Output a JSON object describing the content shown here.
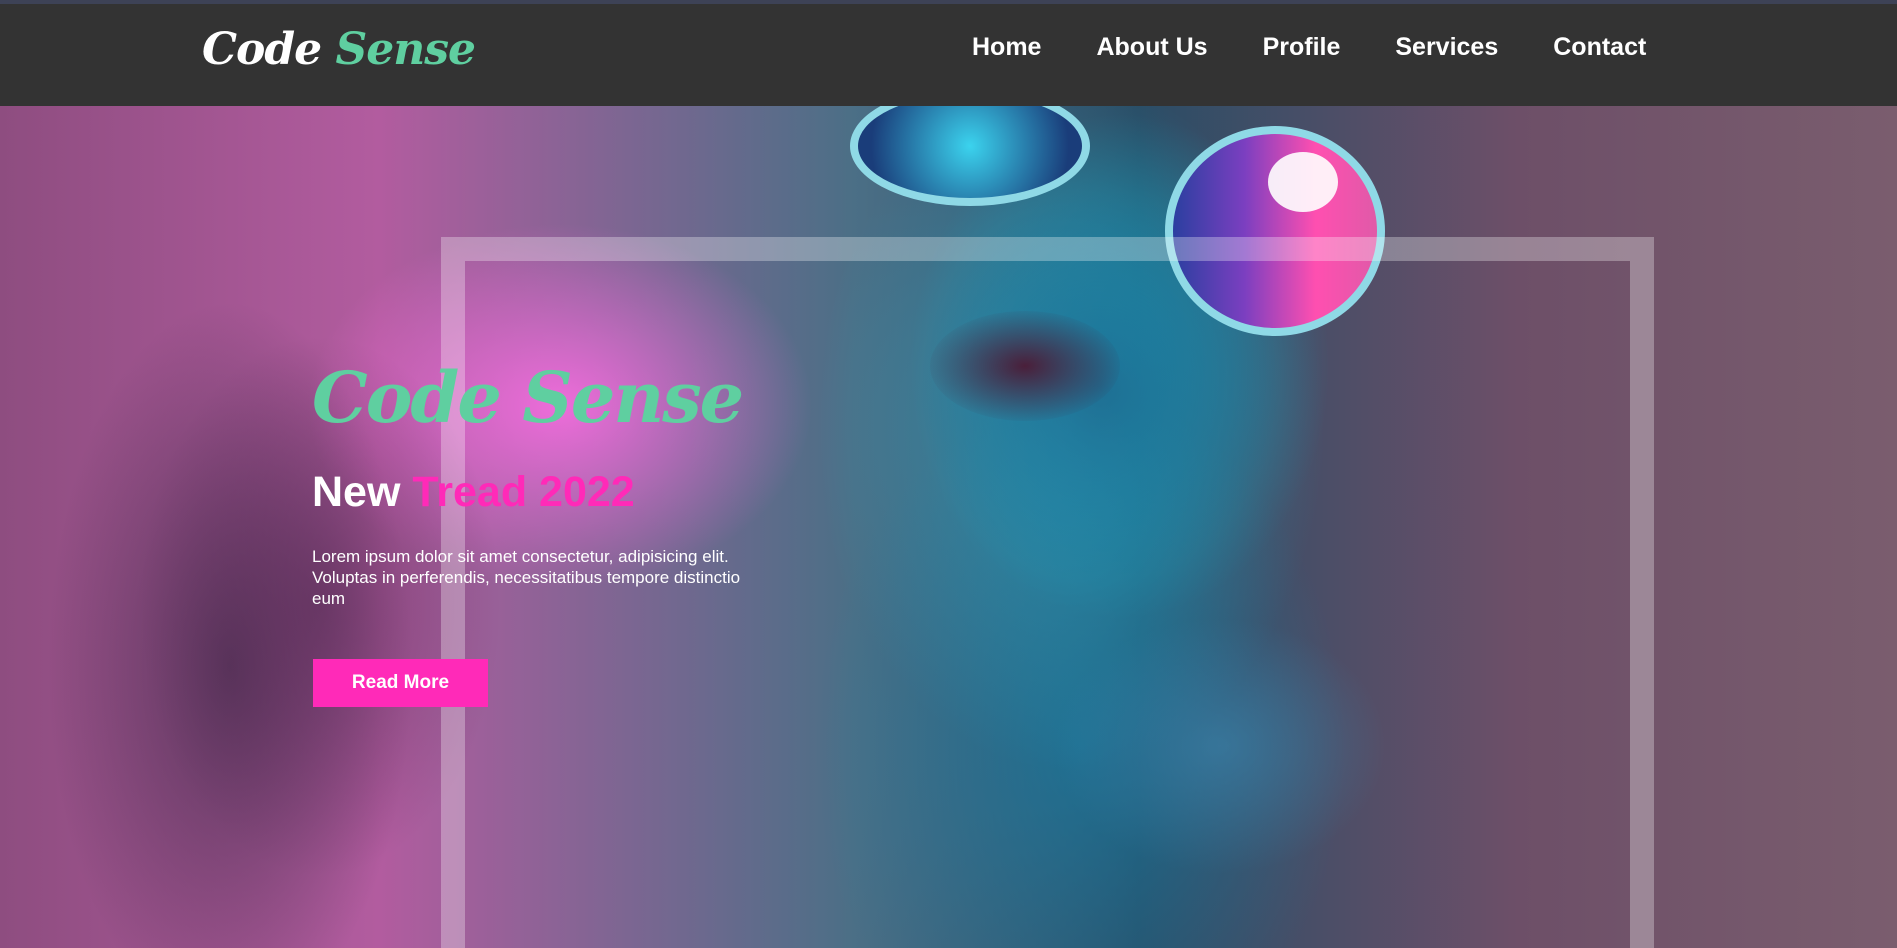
{
  "header": {
    "logo": {
      "part1": "Code",
      "part2": "Sense"
    },
    "nav": [
      {
        "label": "Home"
      },
      {
        "label": "About Us"
      },
      {
        "label": "Profile"
      },
      {
        "label": "Services"
      },
      {
        "label": "Contact"
      }
    ]
  },
  "hero": {
    "logo": {
      "part1": "Code",
      "part2": "Sense"
    },
    "heading": {
      "part1": "New",
      "part2": "Tread 2022"
    },
    "text": "Lorem ipsum dolor sit amet consectetur, adipisicing elit. Voluptas in perferendis, necessitatibus tempore distinctio eum",
    "button_label": "Read More"
  },
  "colors": {
    "navbar": "#333333",
    "logo_accent": "#5fcfa0",
    "heading_accent": "#ff2ab8",
    "button": "#ff2ab8"
  }
}
